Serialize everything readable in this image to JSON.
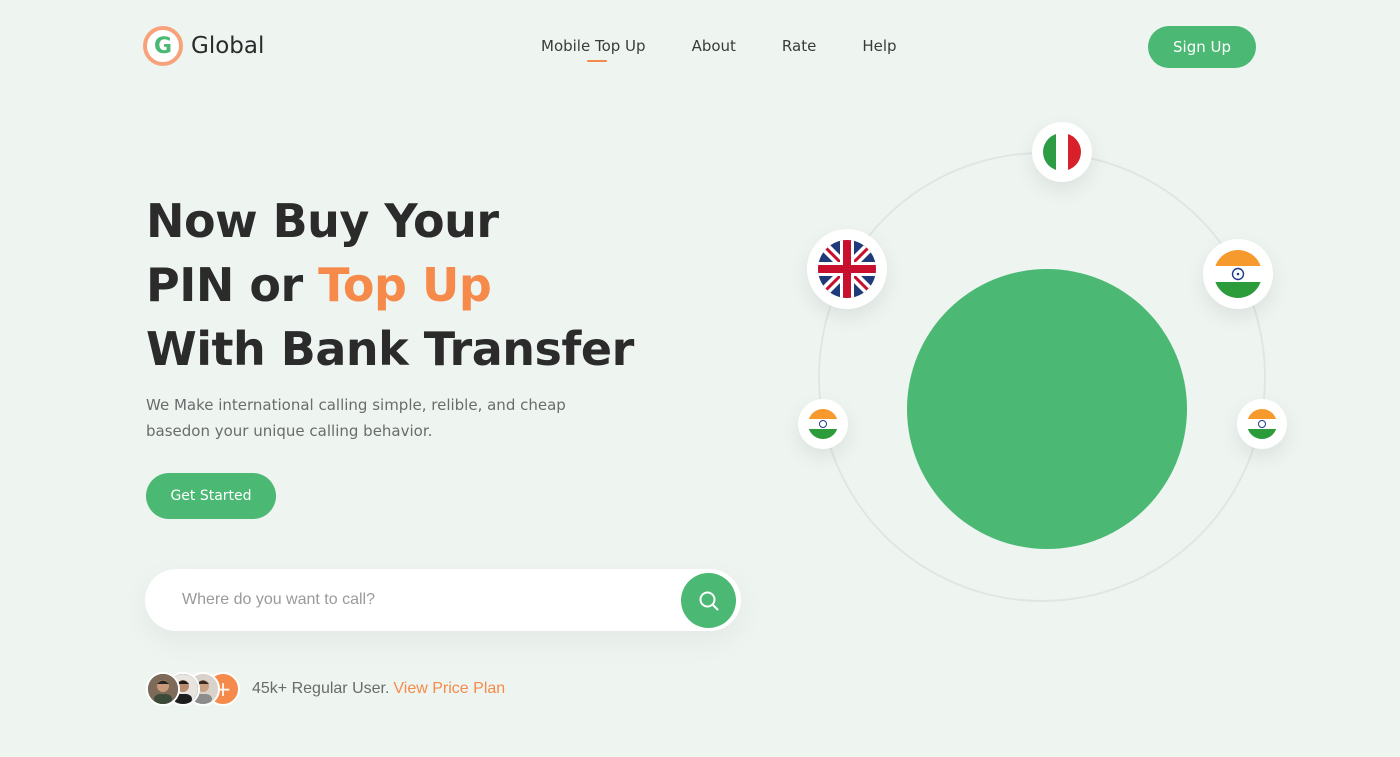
{
  "brand": {
    "logo_letter": "G",
    "name": "Global"
  },
  "nav": {
    "items": [
      {
        "label": "Mobile Top Up",
        "active": true
      },
      {
        "label": "About"
      },
      {
        "label": "Rate"
      },
      {
        "label": "Help"
      }
    ]
  },
  "header": {
    "signup_label": "Sign Up"
  },
  "hero": {
    "line1": "Now Buy Your",
    "line2_prefix": "PIN or ",
    "line2_accent": "Top Up",
    "line3": "With Bank Transfer",
    "subtext_line1": "We Make international calling simple, relible, and cheap",
    "subtext_line2": "basedon your unique calling behavior.",
    "cta_label": "Get Started"
  },
  "search": {
    "placeholder": "Where do you want to call?",
    "value": ""
  },
  "users": {
    "count_text": "45k+ Regular User.",
    "link_label": "View Price Plan",
    "more_glyph": "+"
  },
  "flags": [
    "italy",
    "united-kingdom",
    "india",
    "india",
    "india"
  ],
  "colors": {
    "accent_green": "#4bb874",
    "accent_orange": "#f58a4b",
    "background": "#eef5f1"
  }
}
